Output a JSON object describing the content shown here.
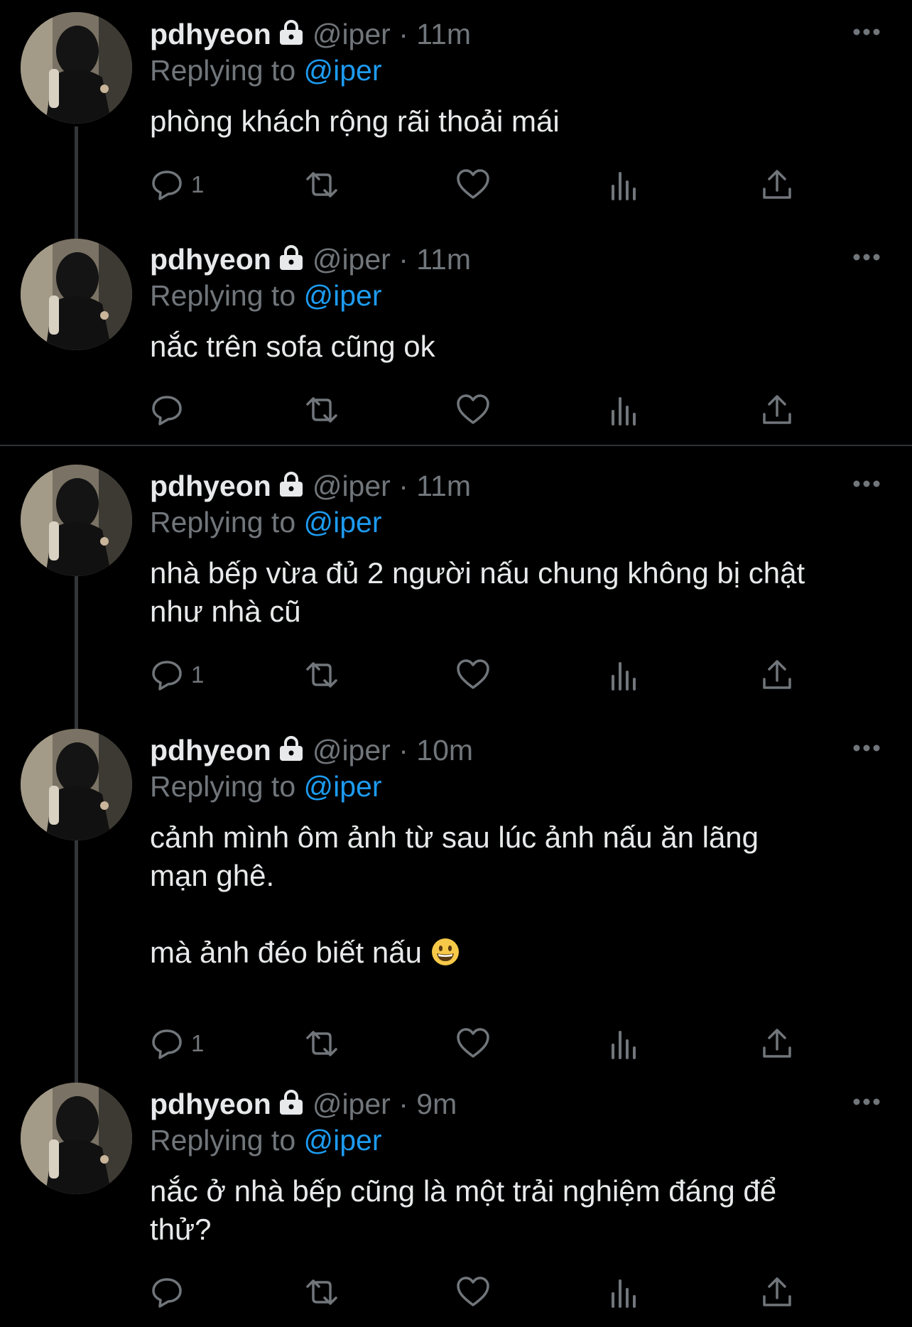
{
  "tweets": [
    {
      "name": "pdhyeon",
      "handle": "@iper",
      "sep": "·",
      "time": "11m",
      "reply_prefix": "Replying to ",
      "reply_to": "@iper",
      "text": "phòng khách rộng rãi thoải mái",
      "reply_count": "1"
    },
    {
      "name": "pdhyeon",
      "handle": "@iper",
      "sep": "·",
      "time": "11m",
      "reply_prefix": "Replying to ",
      "reply_to": "@iper",
      "text": "nắc trên sofa cũng ok",
      "reply_count": ""
    },
    {
      "name": "pdhyeon",
      "handle": "@iper",
      "sep": "·",
      "time": "11m",
      "reply_prefix": "Replying to ",
      "reply_to": "@iper",
      "text": "nhà bếp vừa đủ 2 người nấu chung không bị chật\nnhư nhà cũ",
      "reply_count": "1"
    },
    {
      "name": "pdhyeon",
      "handle": "@iper",
      "sep": "·",
      "time": "10m",
      "reply_prefix": "Replying to ",
      "reply_to": "@iper",
      "text": "cảnh mình ôm ảnh từ sau lúc ảnh nấu ăn lãng\nmạn ghê.\n\nmà ảnh đéo biết nấu",
      "emoji": "grinning-face-emoji",
      "reply_count": "1"
    },
    {
      "name": "pdhyeon",
      "handle": "@iper",
      "sep": "·",
      "time": "9m",
      "reply_prefix": "Replying to ",
      "reply_to": "@iper",
      "text": "nắc ở nhà bếp cũng là một trải nghiệm đáng để\nthử?",
      "reply_count": ""
    }
  ],
  "icons": {
    "lock": "lock-icon",
    "more": "more-icon",
    "reply": "reply-icon",
    "retweet": "retweet-icon",
    "like": "like-icon",
    "views": "views-icon",
    "share": "share-icon"
  },
  "colors": {
    "background": "#000000",
    "text": "#e7e9ea",
    "secondary": "#71767b",
    "link": "#1d9bf0",
    "divider": "#2f3336"
  }
}
